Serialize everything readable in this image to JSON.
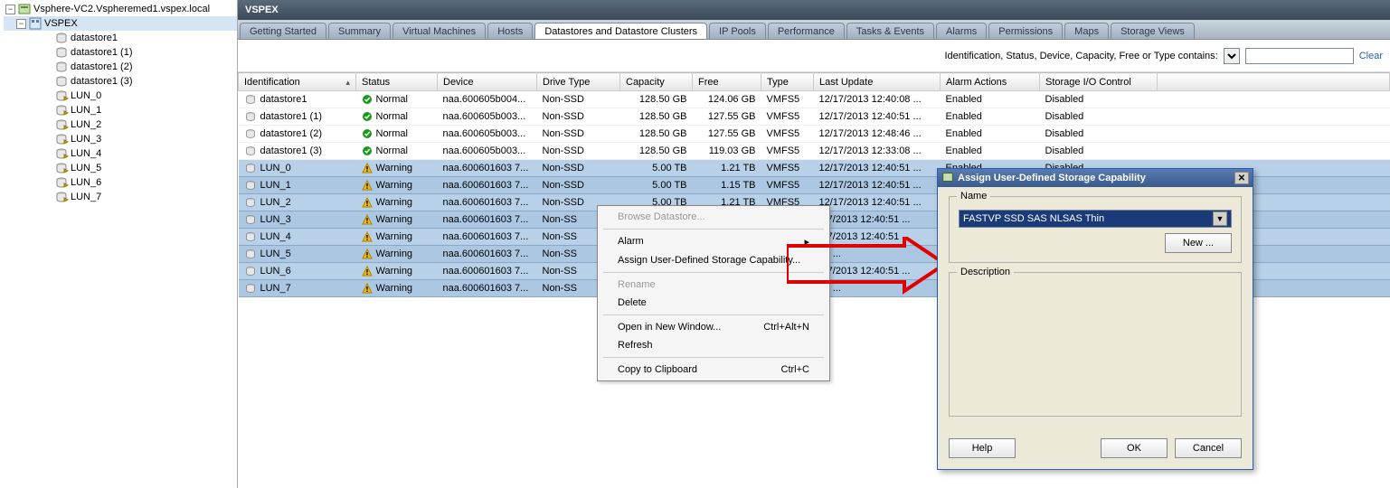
{
  "tree": {
    "root": "Vsphere-VC2.Vspheremed1.vspex.local",
    "datacenter": "VSPEX",
    "items": [
      {
        "label": "datastore1",
        "type": "ds"
      },
      {
        "label": "datastore1 (1)",
        "type": "ds"
      },
      {
        "label": "datastore1 (2)",
        "type": "ds"
      },
      {
        "label": "datastore1 (3)",
        "type": "ds"
      },
      {
        "label": "LUN_0",
        "type": "lun"
      },
      {
        "label": "LUN_1",
        "type": "lun"
      },
      {
        "label": "LUN_2",
        "type": "lun"
      },
      {
        "label": "LUN_3",
        "type": "lun"
      },
      {
        "label": "LUN_4",
        "type": "lun"
      },
      {
        "label": "LUN_5",
        "type": "lun"
      },
      {
        "label": "LUN_6",
        "type": "lun"
      },
      {
        "label": "LUN_7",
        "type": "lun"
      }
    ]
  },
  "header": {
    "title": "VSPEX"
  },
  "tabs": [
    "Getting Started",
    "Summary",
    "Virtual Machines",
    "Hosts",
    "Datastores and Datastore Clusters",
    "IP Pools",
    "Performance",
    "Tasks & Events",
    "Alarms",
    "Permissions",
    "Maps",
    "Storage Views"
  ],
  "active_tab": 4,
  "filter": {
    "label": "Identification, Status, Device, Capacity, Free or Type contains:",
    "clear": "Clear"
  },
  "columns": [
    "Identification",
    "Status",
    "Device",
    "Drive Type",
    "Capacity",
    "Free",
    "Type",
    "Last Update",
    "Alarm Actions",
    "Storage I/O Control"
  ],
  "rows": [
    {
      "id": "datastore1",
      "status": "Normal",
      "ok": true,
      "device": "naa.600605b004...",
      "drive": "Non-SSD",
      "cap": "128.50 GB",
      "free": "124.06 GB",
      "type": "VMFS5",
      "last": "12/17/2013 12:40:08 ...",
      "alarm": "Enabled",
      "sio": "Disabled",
      "sel": false
    },
    {
      "id": "datastore1 (1)",
      "status": "Normal",
      "ok": true,
      "device": "naa.600605b003...",
      "drive": "Non-SSD",
      "cap": "128.50 GB",
      "free": "127.55 GB",
      "type": "VMFS5",
      "last": "12/17/2013 12:40:51 ...",
      "alarm": "Enabled",
      "sio": "Disabled",
      "sel": false
    },
    {
      "id": "datastore1 (2)",
      "status": "Normal",
      "ok": true,
      "device": "naa.600605b003...",
      "drive": "Non-SSD",
      "cap": "128.50 GB",
      "free": "127.55 GB",
      "type": "VMFS5",
      "last": "12/17/2013 12:48:46 ...",
      "alarm": "Enabled",
      "sio": "Disabled",
      "sel": false
    },
    {
      "id": "datastore1 (3)",
      "status": "Normal",
      "ok": true,
      "device": "naa.600605b003...",
      "drive": "Non-SSD",
      "cap": "128.50 GB",
      "free": "119.03 GB",
      "type": "VMFS5",
      "last": "12/17/2013 12:33:08 ...",
      "alarm": "Enabled",
      "sio": "Disabled",
      "sel": false
    },
    {
      "id": "LUN_0",
      "status": "Warning",
      "ok": false,
      "device": "naa.600601603 7...",
      "drive": "Non-SSD",
      "cap": "5.00 TB",
      "free": "1.21 TB",
      "type": "VMFS5",
      "last": "12/17/2013 12:40:51 ...",
      "alarm": "Enabled",
      "sio": "Disabled",
      "sel": true
    },
    {
      "id": "LUN_1",
      "status": "Warning",
      "ok": false,
      "device": "naa.600601603 7...",
      "drive": "Non-SSD",
      "cap": "5.00 TB",
      "free": "1.15 TB",
      "type": "VMFS5",
      "last": "12/17/2013 12:40:51 ...",
      "alarm": "",
      "sio": "",
      "sel": true
    },
    {
      "id": "LUN_2",
      "status": "Warning",
      "ok": false,
      "device": "naa.600601603 7...",
      "drive": "Non-SSD",
      "cap": "5.00 TB",
      "free": "1.21 TB",
      "type": "VMFS5",
      "last": "12/17/2013 12:40:51 ...",
      "alarm": "",
      "sio": "",
      "sel": true
    },
    {
      "id": "LUN_3",
      "status": "Warning",
      "ok": false,
      "device": "naa.600601603 7...",
      "drive": "Non-SS",
      "cap": "",
      "free": "",
      "type": "",
      "last": "/17/2013 12:40:51 ...",
      "alarm": "",
      "sio": "",
      "sel": true
    },
    {
      "id": "LUN_4",
      "status": "Warning",
      "ok": false,
      "device": "naa.600601603 7...",
      "drive": "Non-SS",
      "cap": "",
      "free": "",
      "type": "",
      "last": "/17/2013 12:40:51 ...",
      "alarm": "",
      "sio": "",
      "sel": true
    },
    {
      "id": "LUN_5",
      "status": "Warning",
      "ok": false,
      "device": "naa.600601603 7...",
      "drive": "Non-SS",
      "cap": "",
      "free": "",
      "type": "",
      "last": "51 ...",
      "alarm": "",
      "sio": "",
      "sel": true
    },
    {
      "id": "LUN_6",
      "status": "Warning",
      "ok": false,
      "device": "naa.600601603 7...",
      "drive": "Non-SS",
      "cap": "",
      "free": "",
      "type": "",
      "last": "/17/2013 12:40:51 ...",
      "alarm": "",
      "sio": "",
      "sel": true
    },
    {
      "id": "LUN_7",
      "status": "Warning",
      "ok": false,
      "device": "naa.600601603 7...",
      "drive": "Non-SS",
      "cap": "",
      "free": "",
      "type": "",
      "last": "51 ...",
      "alarm": "",
      "sio": "",
      "sel": true
    }
  ],
  "context_menu": {
    "items": [
      {
        "label": "Browse Datastore...",
        "disabled": true
      },
      {
        "sep": true
      },
      {
        "label": "Alarm",
        "sub": true
      },
      {
        "label": "Assign User-Defined Storage Capability..."
      },
      {
        "sep": true
      },
      {
        "label": "Rename",
        "disabled": true
      },
      {
        "label": "Delete"
      },
      {
        "sep": true
      },
      {
        "label": "Open in New Window...",
        "shortcut": "Ctrl+Alt+N"
      },
      {
        "label": "Refresh"
      },
      {
        "sep": true
      },
      {
        "label": "Copy to Clipboard",
        "shortcut": "Ctrl+C"
      }
    ]
  },
  "dialog": {
    "title": "Assign User-Defined Storage Capability",
    "name_label": "Name",
    "name_value": "FASTVP SSD SAS NLSAS Thin",
    "new_btn": "New ...",
    "desc_label": "Description",
    "help": "Help",
    "ok": "OK",
    "cancel": "Cancel"
  }
}
